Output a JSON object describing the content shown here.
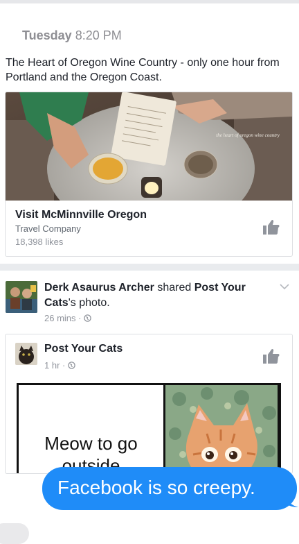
{
  "timestamp": {
    "day": "Tuesday",
    "time": "8:20 PM"
  },
  "ad": {
    "text": "The Heart of Oregon Wine Country - only one hour from Portland and the Oregon Coast.",
    "image_caption": "the heart of oregon wine country",
    "page_name": "Visit McMinnville Oregon",
    "category": "Travel Company",
    "likes": "18,398 likes"
  },
  "post": {
    "author": "Derk Asaurus Archer",
    "shared_verb": "shared",
    "source": "Post Your Cats",
    "suffix": "'s photo.",
    "time": "26 mins",
    "privacy_icon": "globe-icon"
  },
  "shared": {
    "name": "Post Your Cats",
    "time": "1 hr",
    "meme_text": "Meow to go outside"
  },
  "imessage": {
    "text": "Facebook is so creepy.",
    "color": "#1f8cf8"
  },
  "colors": {
    "secondary_text": "#90949c",
    "primary_text": "#1d2129",
    "divider": "#e9ebee"
  }
}
